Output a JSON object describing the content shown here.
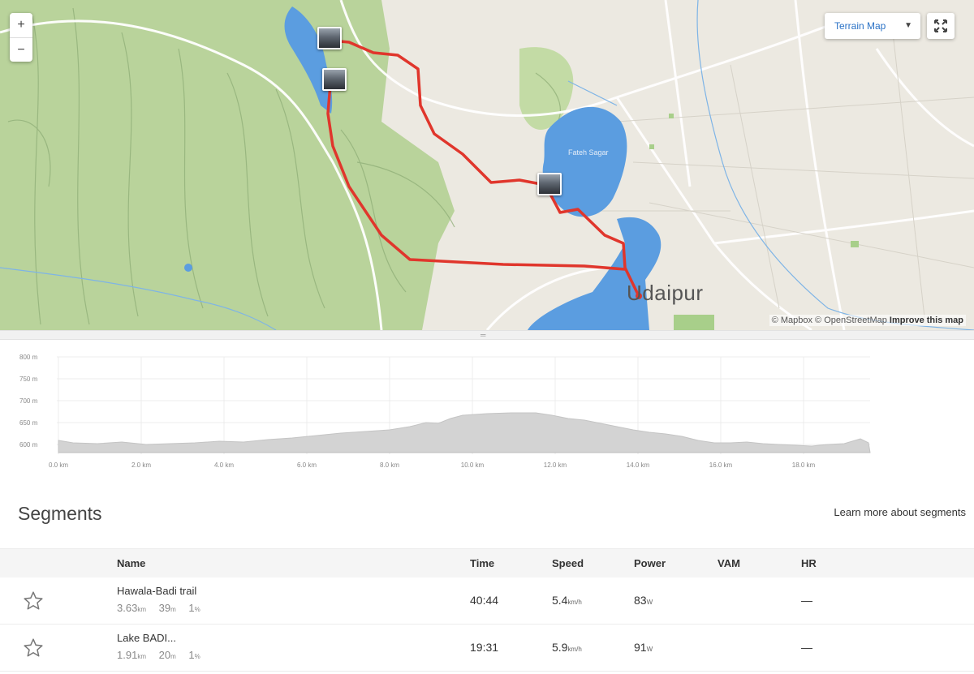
{
  "map": {
    "zoom_in": "+",
    "zoom_out": "−",
    "map_type": "Terrain Map",
    "city": "Udaipur",
    "lake_label": "Fateh Sagar",
    "attribution": {
      "mapbox": "© Mapbox",
      "osm": "© OpenStreetMap",
      "improve": "Improve this map"
    },
    "route_color": "#e0362c",
    "water_color": "#5b9de0",
    "terrain_color": "#b8d29a"
  },
  "elevation": {
    "y_ticks": [
      "800 m",
      "750 m",
      "700 m",
      "650 m",
      "600 m"
    ],
    "x_ticks": [
      "0.0 km",
      "2.0 km",
      "4.0 km",
      "6.0 km",
      "8.0 km",
      "10.0 km",
      "12.0 km",
      "14.0 km",
      "16.0 km",
      "18.0 km"
    ]
  },
  "segments": {
    "title": "Segments",
    "learn_more": "Learn more about segments",
    "columns": {
      "name": "Name",
      "time": "Time",
      "speed": "Speed",
      "power": "Power",
      "vam": "VAM",
      "hr": "HR"
    },
    "rows": [
      {
        "name": "Hawala-Badi trail",
        "distance": "3.63",
        "distance_unit": "km",
        "elev": "39",
        "elev_unit": "m",
        "grade": "1",
        "grade_unit": "%",
        "time": "40:44",
        "speed": "5.4",
        "speed_unit": "km/h",
        "power": "83",
        "power_unit": "W",
        "hr": "—"
      },
      {
        "name": "Lake BADI...",
        "distance": "1.91",
        "distance_unit": "km",
        "elev": "20",
        "elev_unit": "m",
        "grade": "1",
        "grade_unit": "%",
        "time": "19:31",
        "speed": "5.9",
        "speed_unit": "km/h",
        "power": "91",
        "power_unit": "W",
        "hr": "—"
      }
    ]
  }
}
